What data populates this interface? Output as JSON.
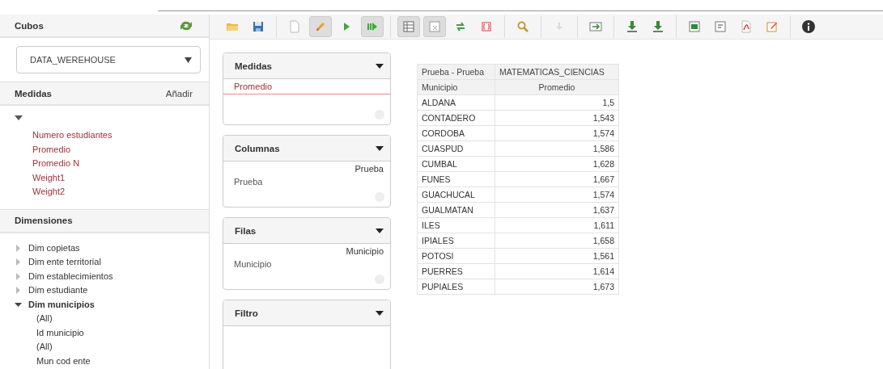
{
  "sidebar": {
    "cubes_title": "Cubos",
    "cube_select": {
      "value": "DATA_WEREHOUSE"
    },
    "measures": {
      "title": "Medidas",
      "add_link": "Añadir",
      "expanded": true,
      "items": [
        "Numero estudiantes",
        "Promedio",
        "Promedio N",
        "Weight1",
        "Weight2"
      ]
    },
    "dimensions": {
      "title": "Dimensiones",
      "items": [
        {
          "label": "Dim copietas",
          "expanded": false
        },
        {
          "label": "Dim ente territorial",
          "expanded": false
        },
        {
          "label": "Dim establecimientos",
          "expanded": false
        },
        {
          "label": "Dim estudiante",
          "expanded": false
        },
        {
          "label": "Dim municipios",
          "expanded": true,
          "children": [
            {
              "label": "(All)"
            },
            {
              "label": "Id municipio"
            },
            {
              "label": "(All)"
            },
            {
              "label": "Mun cod ente"
            }
          ]
        }
      ]
    }
  },
  "toolbar": [
    [
      {
        "kind": "folder",
        "pressed": false
      },
      {
        "kind": "save",
        "pressed": false
      }
    ],
    [
      {
        "kind": "page",
        "pressed": false
      },
      {
        "kind": "pencil",
        "pressed": true
      },
      {
        "kind": "play",
        "pressed": false
      },
      {
        "kind": "play-bars",
        "pressed": true
      }
    ],
    [
      {
        "kind": "table",
        "pressed": true
      },
      {
        "kind": "table-x",
        "pressed": true
      },
      {
        "kind": "swap",
        "pressed": false
      },
      {
        "kind": "brackets",
        "pressed": false
      }
    ],
    [
      {
        "kind": "search",
        "pressed": false
      }
    ],
    [
      {
        "kind": "down",
        "pressed": false
      }
    ],
    [
      {
        "kind": "export-row",
        "pressed": false
      }
    ],
    [
      {
        "kind": "download",
        "pressed": false
      },
      {
        "kind": "download",
        "pressed": false
      }
    ],
    [
      {
        "kind": "sheet",
        "pressed": false
      },
      {
        "kind": "note",
        "pressed": false
      },
      {
        "kind": "pdf",
        "pressed": false
      },
      {
        "kind": "edit",
        "pressed": false
      }
    ],
    [
      {
        "kind": "info",
        "pressed": false
      }
    ]
  ],
  "drop_zones": [
    {
      "title": "Medidas",
      "items": [
        {
          "label": "Promedio",
          "kind": "measure"
        }
      ]
    },
    {
      "title": "Columnas",
      "items": [
        {
          "label": "Prueba",
          "kind": "header"
        },
        {
          "label": "Prueba",
          "kind": "level"
        }
      ]
    },
    {
      "title": "Filas",
      "items": [
        {
          "label": "Municipio",
          "kind": "header"
        },
        {
          "label": "Municipio",
          "kind": "level"
        }
      ]
    },
    {
      "title": "Filtro"
    }
  ],
  "table": {
    "corner": "Prueba - Prueba",
    "column_member": "MATEMATICAS_CIENCIAS",
    "row_header": "Municipio",
    "measure_header": "Promedio",
    "rows": [
      [
        "ALDANA",
        "1,5"
      ],
      [
        "CONTADERO",
        "1,543"
      ],
      [
        "CORDOBA",
        "1,574"
      ],
      [
        "CUASPUD",
        "1,586"
      ],
      [
        "CUMBAL",
        "1,628"
      ],
      [
        "FUNES",
        "1,667"
      ],
      [
        "GUACHUCAL",
        "1,574"
      ],
      [
        "GUALMATAN",
        "1,637"
      ],
      [
        "ILES",
        "1,611"
      ],
      [
        "IPIALES",
        "1,658"
      ],
      [
        "POTOSI",
        "1,561"
      ],
      [
        "PUERRES",
        "1,614"
      ],
      [
        "PUPIALES",
        "1,673"
      ]
    ]
  }
}
